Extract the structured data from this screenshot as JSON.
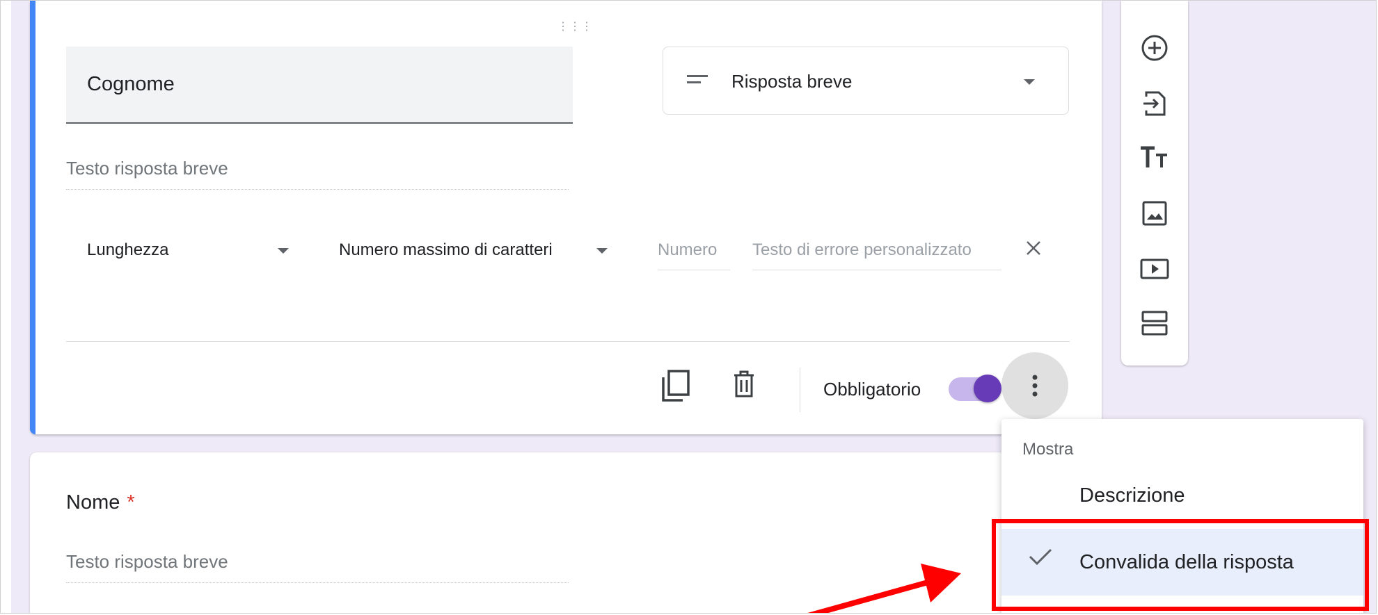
{
  "question_card": {
    "title": "Cognome",
    "type_select_label": "Risposta breve",
    "answer_placeholder": "Testo risposta breve",
    "validation": {
      "type_label": "Lunghezza",
      "rule_label": "Numero massimo di caratteri",
      "number_placeholder": "Numero",
      "error_placeholder": "Testo di errore personalizzato"
    },
    "required_label": "Obbligatorio",
    "required_on": true
  },
  "next_question": {
    "title": "Nome",
    "required_marker": "*",
    "answer_placeholder": "Testo risposta breve"
  },
  "more_menu": {
    "header": "Mostra",
    "items": [
      {
        "label": "Descrizione",
        "checked": false
      },
      {
        "label": "Convalida della risposta",
        "checked": true
      }
    ]
  },
  "side_toolbar": {
    "tools": [
      "add-question-icon",
      "import-questions-icon",
      "add-title-icon",
      "add-image-icon",
      "add-video-icon",
      "add-section-icon"
    ]
  },
  "colors": {
    "accent_blue": "#4285f4",
    "toggle_purple": "#673ab7",
    "background_lavender": "#efeaf8",
    "annotation_red": "#ff0000",
    "menu_selected": "#e8eefb"
  }
}
